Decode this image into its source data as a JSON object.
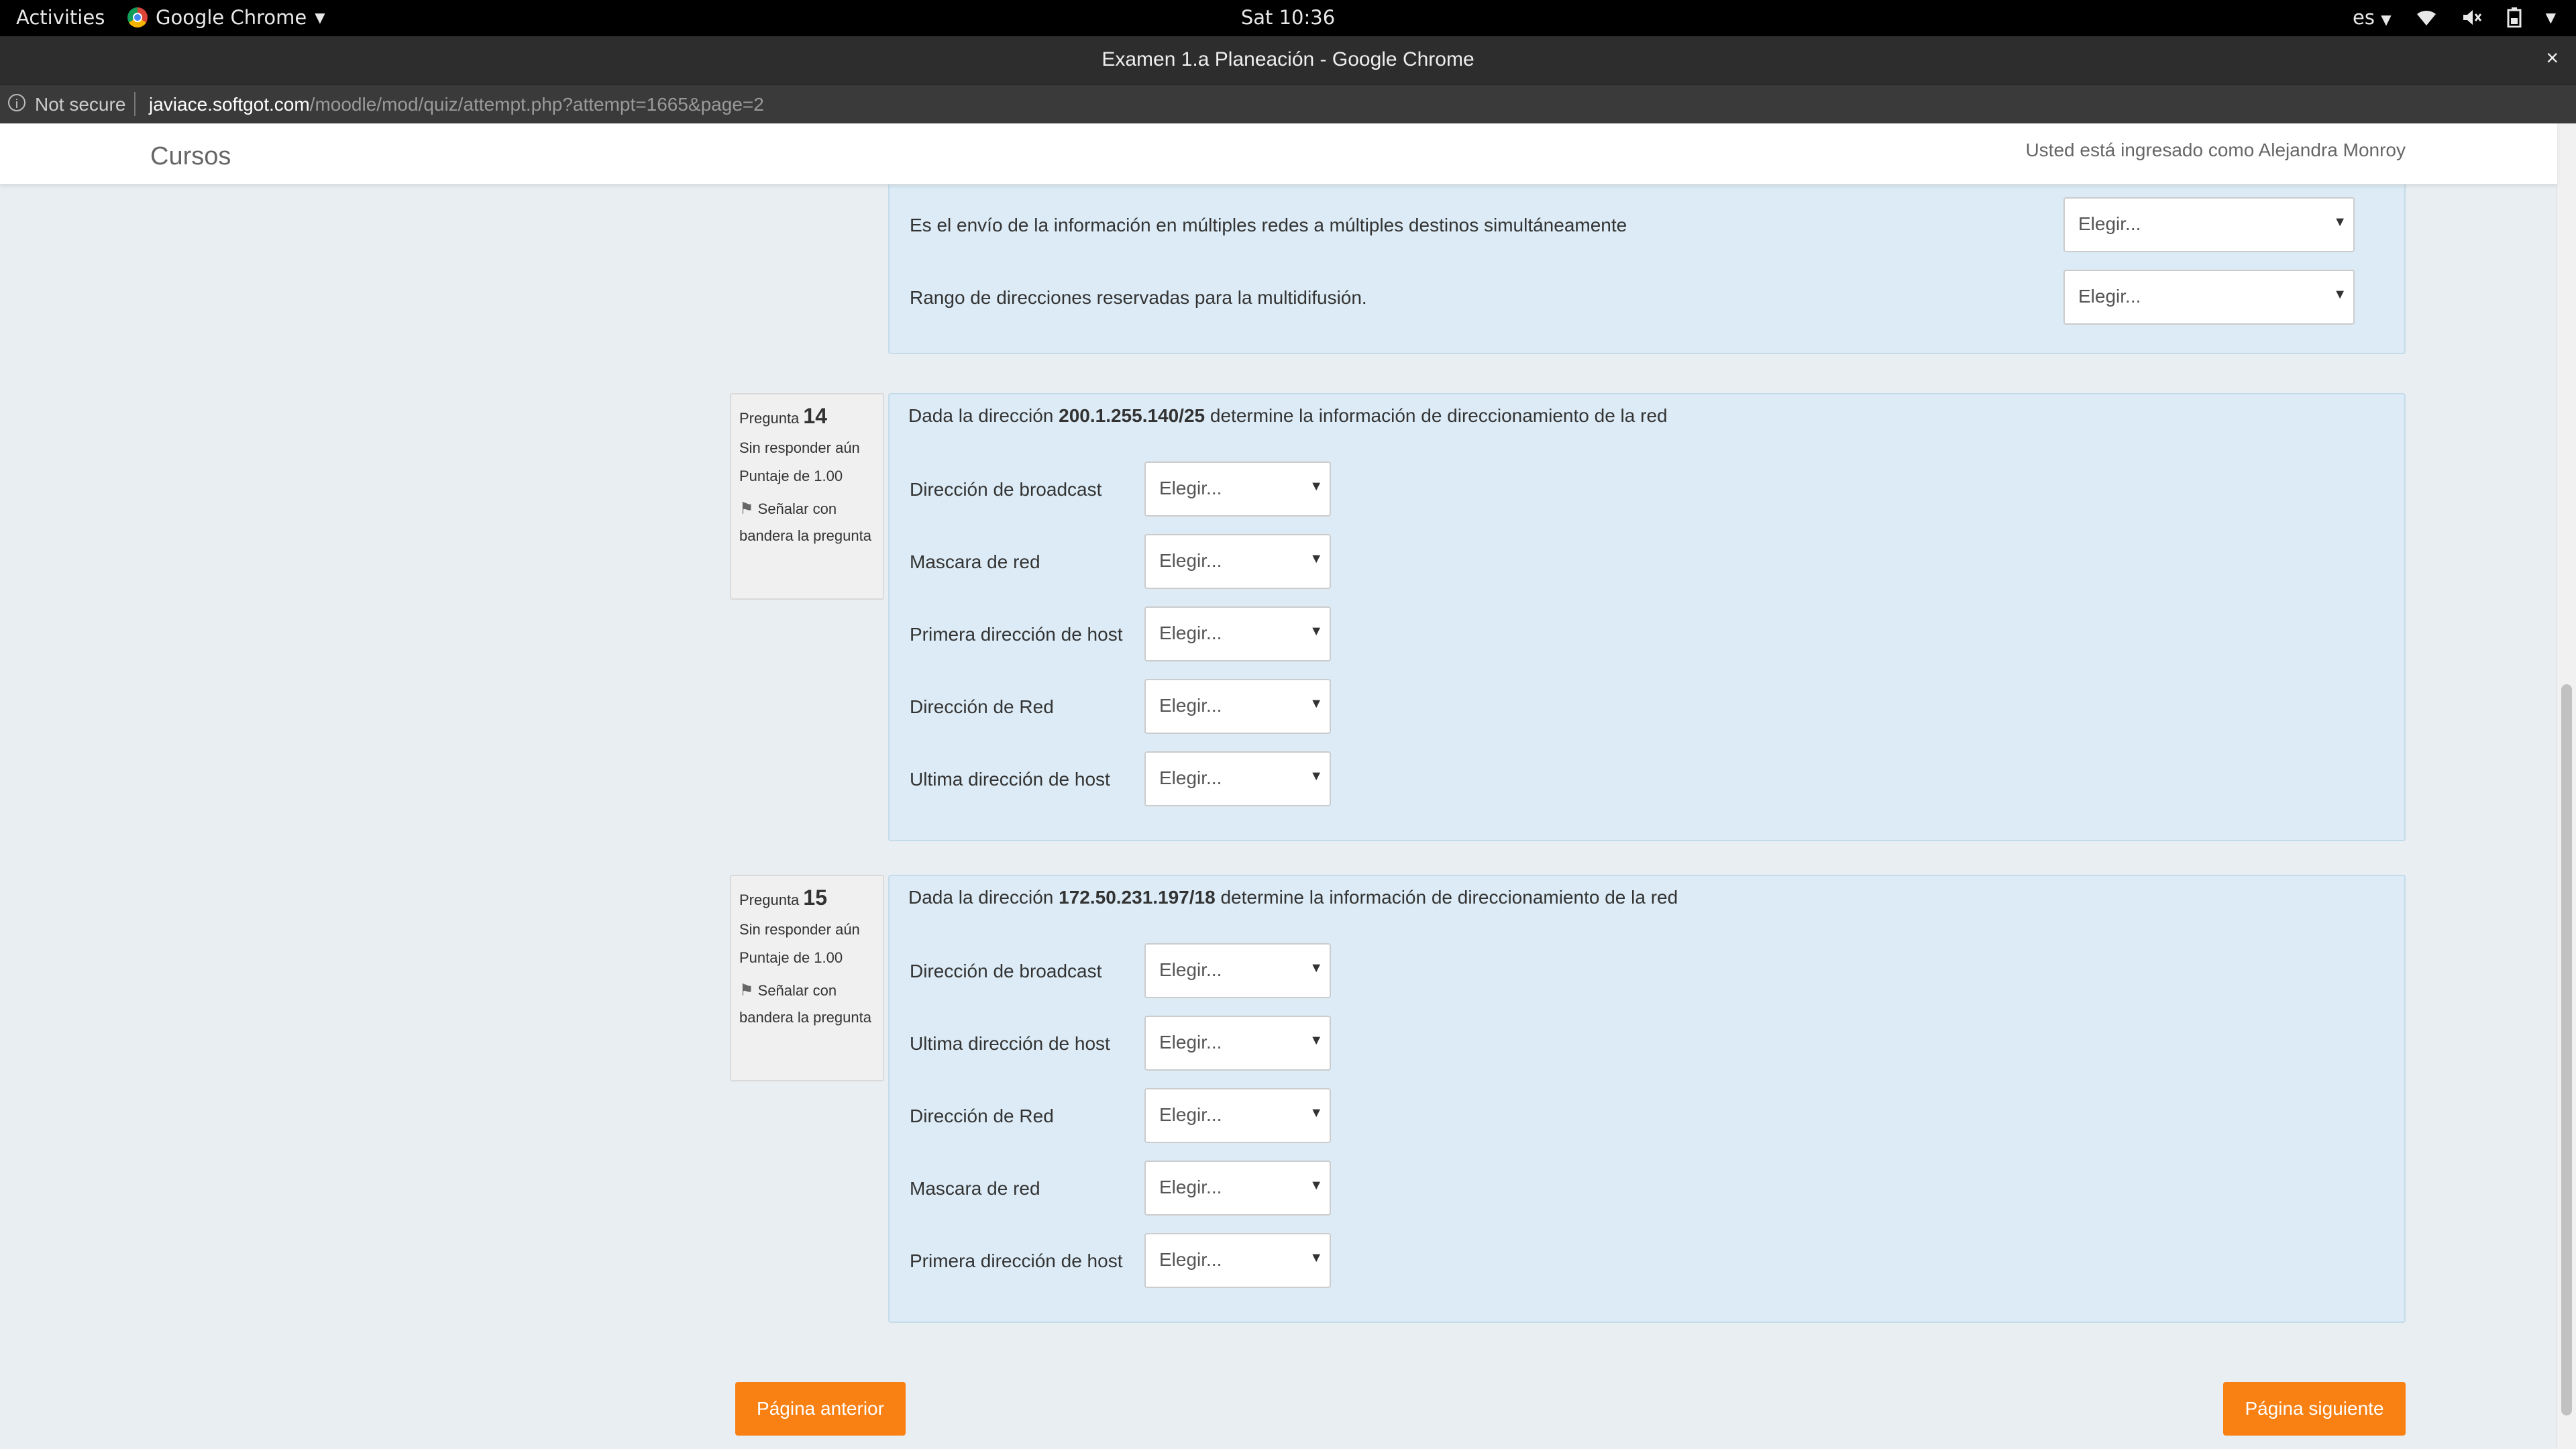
{
  "system": {
    "activities": "Activities",
    "app": "Google Chrome",
    "clock": "Sat 10:36",
    "lang": "es"
  },
  "window": {
    "title": "Examen 1.a Planeación - Google Chrome",
    "close": "×"
  },
  "url": {
    "security": "Not secure",
    "host": "javiace.softgot.com",
    "path": "/moodle/mod/quiz/attempt.php?attempt=1665&page=2"
  },
  "nav": {
    "brand": "Cursos",
    "user": "Usted está ingresado como Alejandra Monroy"
  },
  "select_placeholder": "Elegir...",
  "q13": {
    "items": [
      "Es el envío de la información en múltiples redes a múltiples destinos simultáneamente",
      "Rango de direcciones reservadas para la multidifusión."
    ]
  },
  "q14": {
    "label": "Pregunta",
    "number": "14",
    "status": "Sin responder aún",
    "score": "Puntaje de 1.00",
    "flag": "Señalar con bandera la pregunta",
    "text_pre": "Dada la dirección ",
    "address": "200.1.255.140/25",
    "text_post": " determine la información de direccionamiento de la red",
    "items": [
      "Dirección de broadcast",
      "Mascara de red",
      "Primera dirección de host",
      "Dirección de Red",
      "Ultima dirección de host"
    ]
  },
  "q15": {
    "label": "Pregunta",
    "number": "15",
    "status": "Sin responder aún",
    "score": "Puntaje de 1.00",
    "flag": "Señalar con bandera la pregunta",
    "text_pre": "Dada la dirección ",
    "address": "172.50.231.197/18",
    "text_post": " determine la información de direccionamiento de la red",
    "items": [
      "Dirección de broadcast",
      "Ultima dirección de host",
      "Dirección de Red",
      "Mascara de red",
      "Primera dirección de host"
    ]
  },
  "buttons": {
    "prev": "Página anterior",
    "next": "Página siguiente"
  }
}
